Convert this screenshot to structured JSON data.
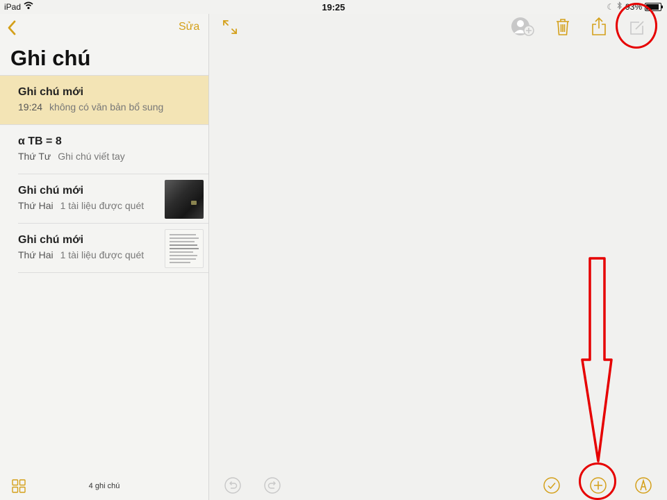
{
  "status_bar": {
    "device": "iPad",
    "time": "19:25",
    "battery": "93%"
  },
  "sidebar": {
    "edit_label": "Sửa",
    "title": "Ghi chú",
    "notes": [
      {
        "title": "Ghi chú mới",
        "date": "19:24",
        "preview": "không có văn bản bổ sung",
        "thumbnail": "none",
        "selected": true
      },
      {
        "title": "α TB = 8",
        "date": "Thứ Tư",
        "preview": "Ghi chú viết tay",
        "thumbnail": "none",
        "selected": false
      },
      {
        "title": "Ghi chú mới",
        "date": "Thứ Hai",
        "preview": "1 tài liệu được quét",
        "thumbnail": "photo",
        "selected": false
      },
      {
        "title": "Ghi chú mới",
        "date": "Thứ Hai",
        "preview": "1 tài liệu được quét",
        "thumbnail": "scanned-document",
        "selected": false
      }
    ],
    "note_count": "4 ghi chú"
  },
  "toolbar_icons": {
    "top": [
      "expand-icon",
      "add-people-icon",
      "trash-icon",
      "share-icon",
      "compose-icon"
    ],
    "bottom": [
      "undo-icon",
      "redo-icon",
      "checklist-icon",
      "add-icon",
      "markup-pen-icon"
    ]
  },
  "colors": {
    "accent": "#d4a01a",
    "selected_row": "#f3e4b5",
    "annotation": "#e60000"
  }
}
